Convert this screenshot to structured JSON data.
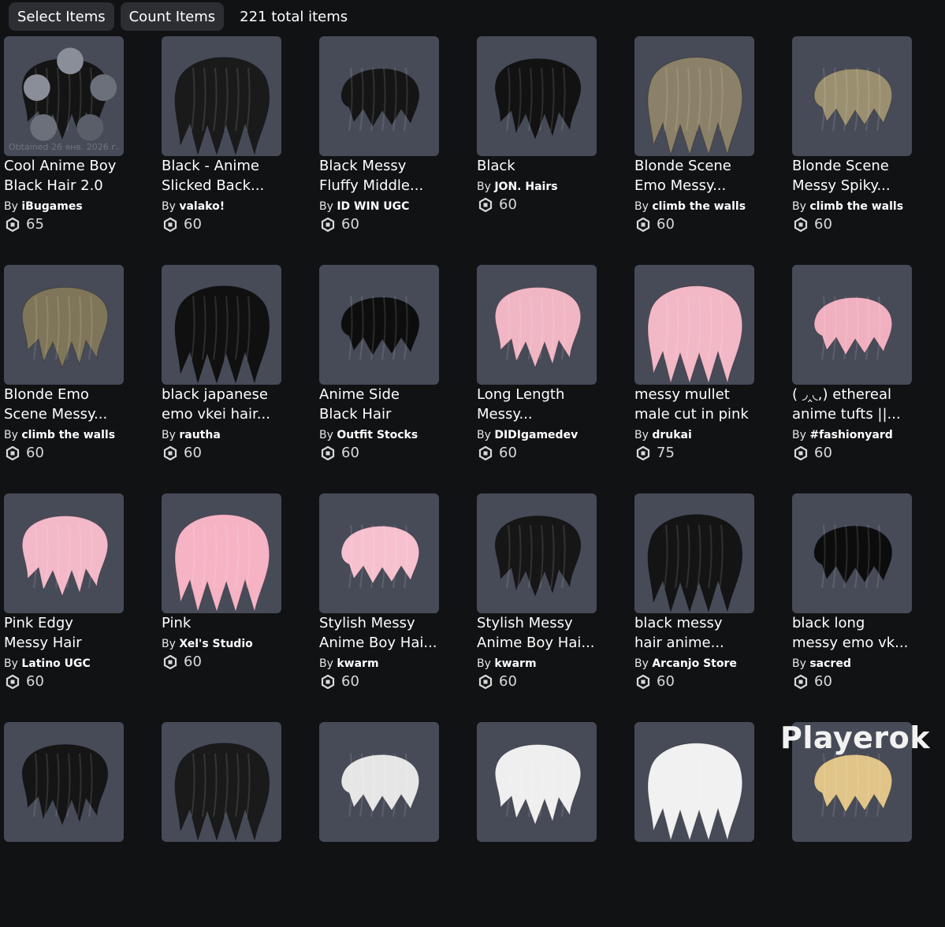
{
  "toolbar": {
    "select_label": "Select Items",
    "count_label": "Count Items",
    "total_label": "221 total items"
  },
  "currency_icon": "robux-icon",
  "items": [
    {
      "name": "Cool Anime Boy\nBlack Hair 2.0",
      "by": "By",
      "creator": "iBugames",
      "price": "65",
      "hair_color": "#141414",
      "obtained": "Obtained 26 янв. 2026 г."
    },
    {
      "name": "Black - Anime\nSlicked Back...",
      "by": "By",
      "creator": "valako!",
      "price": "60",
      "hair_color": "#1a1a1a"
    },
    {
      "name": "Black Messy\nFluffy Middle...",
      "by": "By",
      "creator": "ID WIN UGC",
      "price": "60",
      "hair_color": "#151515"
    },
    {
      "name": "Black",
      "by": "By",
      "creator": "JON. Hairs",
      "price": "60",
      "hair_color": "#121212"
    },
    {
      "name": "Blonde Scene\nEmo Messy...",
      "by": "By",
      "creator": "climb the walls",
      "price": "60",
      "hair_color": "#8b8168"
    },
    {
      "name": "Blonde Scene\nMessy Spiky...",
      "by": "By",
      "creator": "climb the walls",
      "price": "60",
      "hair_color": "#9a8f6f"
    },
    {
      "name": "Blonde Emo\nScene Messy...",
      "by": "By",
      "creator": "climb the walls",
      "price": "60",
      "hair_color": "#7f7659"
    },
    {
      "name": "black japanese\nemo vkei hair...",
      "by": "By",
      "creator": "rautha",
      "price": "60",
      "hair_color": "#101010"
    },
    {
      "name": "Anime Side\nBlack Hair",
      "by": "By",
      "creator": "Outfit Stocks",
      "price": "60",
      "hair_color": "#0d0d0d"
    },
    {
      "name": "Long Length\nMessy...",
      "by": "By",
      "creator": "DIDIgamedev",
      "price": "60",
      "hair_color": "#f0b6c4"
    },
    {
      "name": "messy mullet\nmale cut in pink",
      "by": "By",
      "creator": "drukai",
      "price": "75",
      "hair_color": "#f2b8c6"
    },
    {
      "name": "( ◞‸◟,) ethereal\nanime tufts ||...",
      "by": "By",
      "creator": "#fashionyard",
      "price": "60",
      "hair_color": "#f0b0c0"
    },
    {
      "name": "Pink Edgy\nMessy Hair",
      "by": "By",
      "creator": "Latino UGC",
      "price": "60",
      "hair_color": "#f3b9c8"
    },
    {
      "name": "    Pink",
      "by": "By",
      "creator": "Xel's Studio",
      "price": "60",
      "hair_color": "#f5b3c4"
    },
    {
      "name": "Stylish Messy\nAnime Boy Hai...",
      "by": "By",
      "creator": "kwarm",
      "price": "60",
      "hair_color": "#f6c0cf"
    },
    {
      "name": "Stylish Messy\nAnime Boy Hai...",
      "by": "By",
      "creator": "kwarm",
      "price": "60",
      "hair_color": "#161616"
    },
    {
      "name": "black messy\nhair anime...",
      "by": "By",
      "creator": "Arcanjo Store",
      "price": "60",
      "hair_color": "#141414"
    },
    {
      "name": "black long\nmessy emo vk...",
      "by": "By",
      "creator": "sacred",
      "price": "60",
      "hair_color": "#0c0c0c"
    },
    {
      "name": "",
      "by": "",
      "creator": "",
      "price": "",
      "hair_color": "#151515"
    },
    {
      "name": "",
      "by": "",
      "creator": "",
      "price": "",
      "hair_color": "#1a1a1a"
    },
    {
      "name": "",
      "by": "",
      "creator": "",
      "price": "",
      "hair_color": "#e6e6e6"
    },
    {
      "name": "",
      "by": "",
      "creator": "",
      "price": "",
      "hair_color": "#efefef"
    },
    {
      "name": "",
      "by": "",
      "creator": "",
      "price": "",
      "hair_color": "#f1f1f1"
    },
    {
      "name": "",
      "by": "",
      "creator": "",
      "price": "",
      "hair_color": "#e0c488"
    }
  ],
  "watermark": "Playerok"
}
